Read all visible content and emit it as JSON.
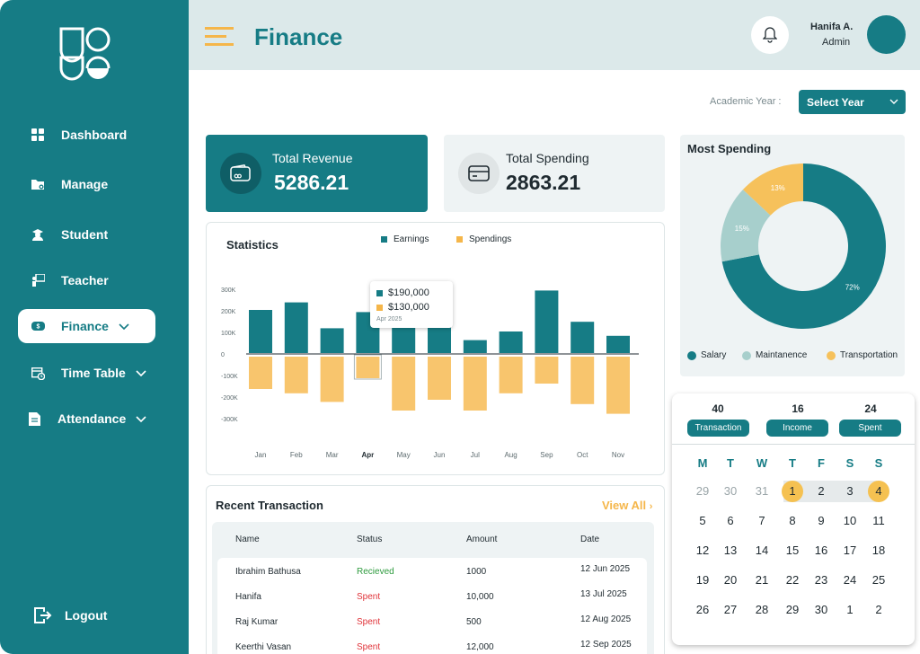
{
  "header": {
    "title": "Finance",
    "user_name": "Hanifa A.",
    "user_role": "Admin"
  },
  "sidebar": {
    "items": [
      {
        "label": "Dashboard"
      },
      {
        "label": "Manage"
      },
      {
        "label": "Student"
      },
      {
        "label": "Teacher"
      },
      {
        "label": "Finance"
      },
      {
        "label": "Time Table"
      },
      {
        "label": "Attendance"
      }
    ],
    "logout": "Logout"
  },
  "filter": {
    "label": "Academic Year :",
    "value": "Select Year"
  },
  "cards": {
    "revenue": {
      "label": "Total Revenue",
      "value": "5286.21"
    },
    "spending": {
      "label": "Total Spending",
      "value": "2863.21"
    }
  },
  "stats": {
    "title": "Statistics",
    "legend_earnings": "Earnings",
    "legend_spendings": "Spendings",
    "y_ticks": [
      "300K",
      "200K",
      "100K",
      "0",
      "-100K",
      "-200K",
      "-300K"
    ],
    "tooltip": {
      "earnings": "$190,000",
      "spendings": "$130,000",
      "date": "Apr 2025"
    }
  },
  "chart_data": [
    {
      "type": "bar",
      "title": "Statistics",
      "categories": [
        "Jan",
        "Feb",
        "Mar",
        "Apr",
        "May",
        "Jun",
        "Jul",
        "Aug",
        "Sep",
        "Oct",
        "Nov"
      ],
      "series": [
        {
          "name": "Earnings",
          "values": [
            200000,
            235000,
            115000,
            190000,
            130000,
            140000,
            60000,
            100000,
            290000,
            145000,
            80000
          ]
        },
        {
          "name": "Spendings",
          "values": [
            -150000,
            -170000,
            -210000,
            -100000,
            -250000,
            -200000,
            -250000,
            -170000,
            -125000,
            -220000,
            -265000
          ]
        }
      ],
      "ylim": [
        -300000,
        300000
      ],
      "colors": [
        "#167c85",
        "#f8c56d"
      ]
    },
    {
      "type": "pie",
      "title": "Most Spending",
      "categories": [
        "Salary",
        "Maintanence",
        "Transportation"
      ],
      "values": [
        72,
        15,
        13
      ],
      "labels": [
        "72%",
        "15%",
        "13%"
      ],
      "colors": [
        "#167c85",
        "#a7cfcc",
        "#f6c15b"
      ]
    }
  ],
  "most_spending": {
    "title": "Most Spending"
  },
  "recent": {
    "title": "Recent Transaction",
    "view_all": "View All",
    "columns": [
      "Name",
      "Status",
      "Amount",
      "Date"
    ],
    "rows": [
      {
        "name": "Ibrahim Bathusa",
        "status": "Recieved",
        "amount": "1000",
        "date": "12 Jun 2025"
      },
      {
        "name": "Hanifa",
        "status": "Spent",
        "amount": "10,000",
        "date": "13 Jul 2025"
      },
      {
        "name": "Raj Kumar",
        "status": "Spent",
        "amount": "500",
        "date": "12 Aug 2025"
      },
      {
        "name": "Keerthi Vasan",
        "status": "Spent",
        "amount": "12,000",
        "date": "12 Sep 2025"
      }
    ]
  },
  "calendar": {
    "stats": [
      {
        "count": "40",
        "label": "Transaction"
      },
      {
        "count": "16",
        "label": "Income"
      },
      {
        "count": "24",
        "label": "Spent"
      }
    ],
    "weekdays": [
      "M",
      "T",
      "W",
      "T",
      "F",
      "S",
      "S"
    ],
    "weeks": [
      [
        "29",
        "30",
        "31",
        "1",
        "2",
        "3",
        "4"
      ],
      [
        "5",
        "6",
        "7",
        "8",
        "9",
        "10",
        "11"
      ],
      [
        "12",
        "13",
        "14",
        "15",
        "16",
        "17",
        "18"
      ],
      [
        "19",
        "20",
        "21",
        "22",
        "23",
        "24",
        "25"
      ],
      [
        "26",
        "27",
        "28",
        "29",
        "30",
        "1",
        "2"
      ]
    ]
  }
}
